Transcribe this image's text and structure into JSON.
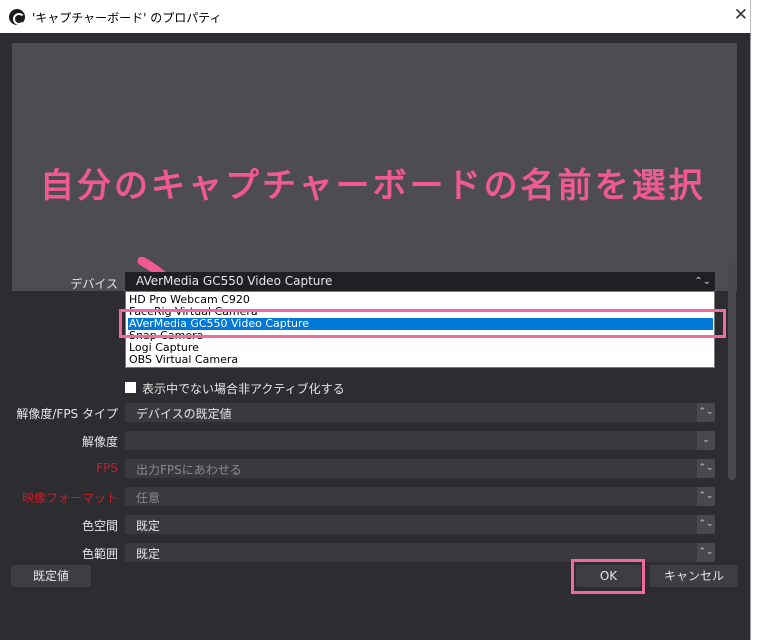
{
  "window": {
    "title": "'キャプチャーボード' のプロパティ"
  },
  "annotation": {
    "text": "自分のキャプチャーボードの名前を選択",
    "color": "#f15a8e"
  },
  "device": {
    "label": "デバイス",
    "selected": "AVerMedia GC550 Video Capture",
    "options": [
      "HD Pro Webcam C920",
      "FaceRig Virtual Camera",
      "AVerMedia GC550 Video Capture",
      "Snap Camera",
      "Logi Capture",
      "OBS Virtual Camera"
    ],
    "highlighted_index": 2
  },
  "checkbox": {
    "label": "表示中でない場合非アクティブ化する",
    "checked": false
  },
  "properties": [
    {
      "label": "解像度/FPS タイプ",
      "value": "デバイスの既定値",
      "control": "spin",
      "label_red": false,
      "disabled": false
    },
    {
      "label": "解像度",
      "value": "",
      "control": "dropdown",
      "label_red": false,
      "disabled": false
    },
    {
      "label": "FPS",
      "value": "出力FPSにあわせる",
      "control": "spin",
      "label_red": true,
      "disabled": true
    },
    {
      "label": "映像フォーマット",
      "value": "任意",
      "control": "spin",
      "label_red": true,
      "disabled": true
    },
    {
      "label": "色空間",
      "value": "既定",
      "control": "spin",
      "label_red": false,
      "disabled": false
    },
    {
      "label": "色範囲",
      "value": "既定",
      "control": "spin",
      "label_red": false,
      "disabled": false
    }
  ],
  "buttons": {
    "defaults": "既定値",
    "ok": "OK",
    "cancel": "キャンセル"
  },
  "colors": {
    "highlight": "#f06a9c",
    "selection": "#0078d7",
    "warning_label": "#c0202a"
  }
}
